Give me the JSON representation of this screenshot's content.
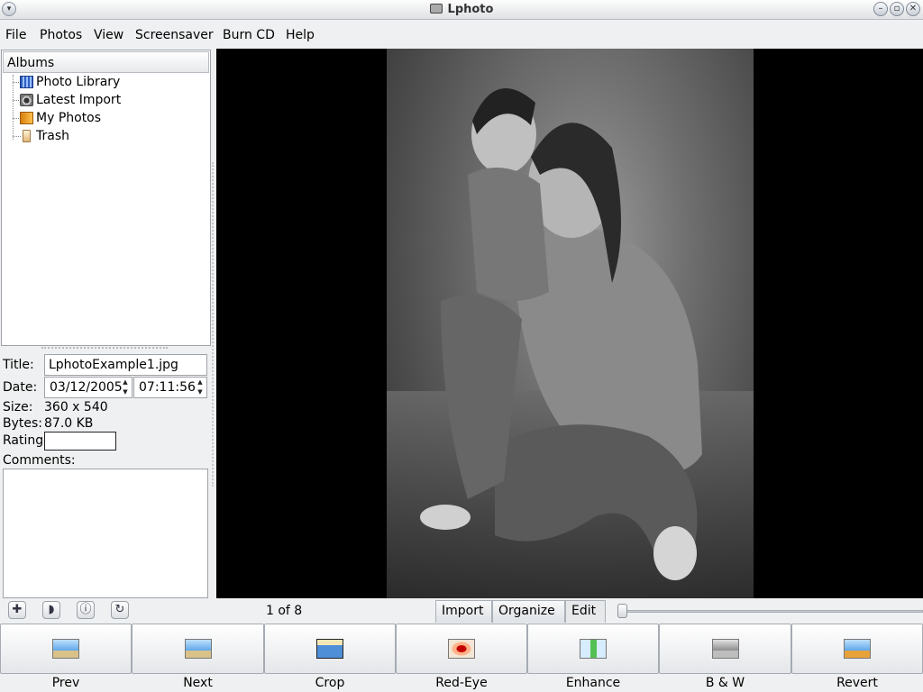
{
  "window": {
    "title": "Lphoto"
  },
  "menu": [
    "File",
    "Photos",
    "View",
    "Screensaver",
    "Burn CD",
    "Help"
  ],
  "albums": {
    "header": "Albums",
    "items": [
      {
        "label": "Photo Library",
        "icon": "photo-library-icon"
      },
      {
        "label": "Latest Import",
        "icon": "camera-icon"
      },
      {
        "label": "My Photos",
        "icon": "folder-icon"
      },
      {
        "label": "Trash",
        "icon": "trash-icon"
      }
    ]
  },
  "properties": {
    "title_label": "Title:",
    "title_value": "LphotoExample1.jpg",
    "date_label": "Date:",
    "date_value": "03/12/2005",
    "time_value": "07:11:56",
    "size_label": "Size:",
    "size_value": "360 x 540",
    "bytes_label": "Bytes:",
    "bytes_value": "87.0 KB",
    "rating_label": "Rating:",
    "rating_value": "",
    "comments_label": "Comments:",
    "comments_value": ""
  },
  "navigator": {
    "counter": "1 of 8"
  },
  "tabs": [
    "Import",
    "Organize",
    "Edit"
  ],
  "active_tab": "Edit",
  "actions": [
    "Prev",
    "Next",
    "Crop",
    "Red-Eye",
    "Enhance",
    "B & W",
    "Revert"
  ],
  "colors": {
    "window_bg": "#eff0f1",
    "viewer_bg": "#000000"
  }
}
